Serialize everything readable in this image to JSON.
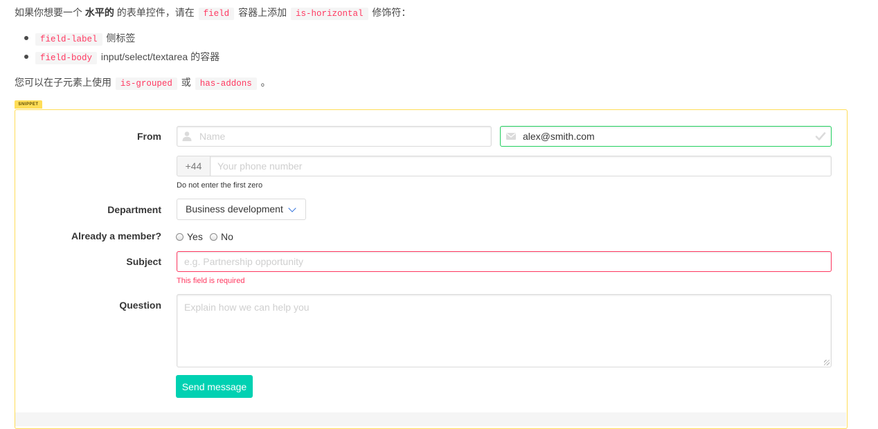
{
  "intro": {
    "p1_before": "如果你想要一个",
    "p1_strong": "水平的",
    "p1_mid1": "的表单控件，请在",
    "p1_code1": "field",
    "p1_mid2": "容器上添加",
    "p1_code2": "is-horizontal",
    "p1_after": "修饰符：",
    "items": [
      {
        "code": "field-label",
        "text": "侧标签"
      },
      {
        "code": "field-body",
        "text": "input/select/textarea 的容器"
      }
    ],
    "p2_before": "您可以在子元素上使用",
    "p2_code1": "is-grouped",
    "p2_mid": "或",
    "p2_code2": "has-addons",
    "p2_after": "。"
  },
  "snippet_tag": "SNIPPET",
  "form": {
    "from_label": "From",
    "name_placeholder": "Name",
    "email_value": "alex@smith.com",
    "phone_prefix": "+44",
    "phone_placeholder": "Your phone number",
    "phone_help": "Do not enter the first zero",
    "department_label": "Department",
    "department_selected": "Business development",
    "member_label": "Already a member?",
    "member_yes": "Yes",
    "member_no": "No",
    "subject_label": "Subject",
    "subject_placeholder": "e.g. Partnership opportunity",
    "subject_help": "This field is required",
    "question_label": "Question",
    "question_placeholder": "Explain how we can help you",
    "send_label": "Send message"
  },
  "colors": {
    "accent": "#00d1b2",
    "success": "#23d160",
    "danger": "#ff3860",
    "snippet": "#ffdd57"
  },
  "icons": {
    "name": "user-icon",
    "email": "envelope-icon",
    "email_status": "check-icon",
    "department": "chevron-down-icon"
  }
}
